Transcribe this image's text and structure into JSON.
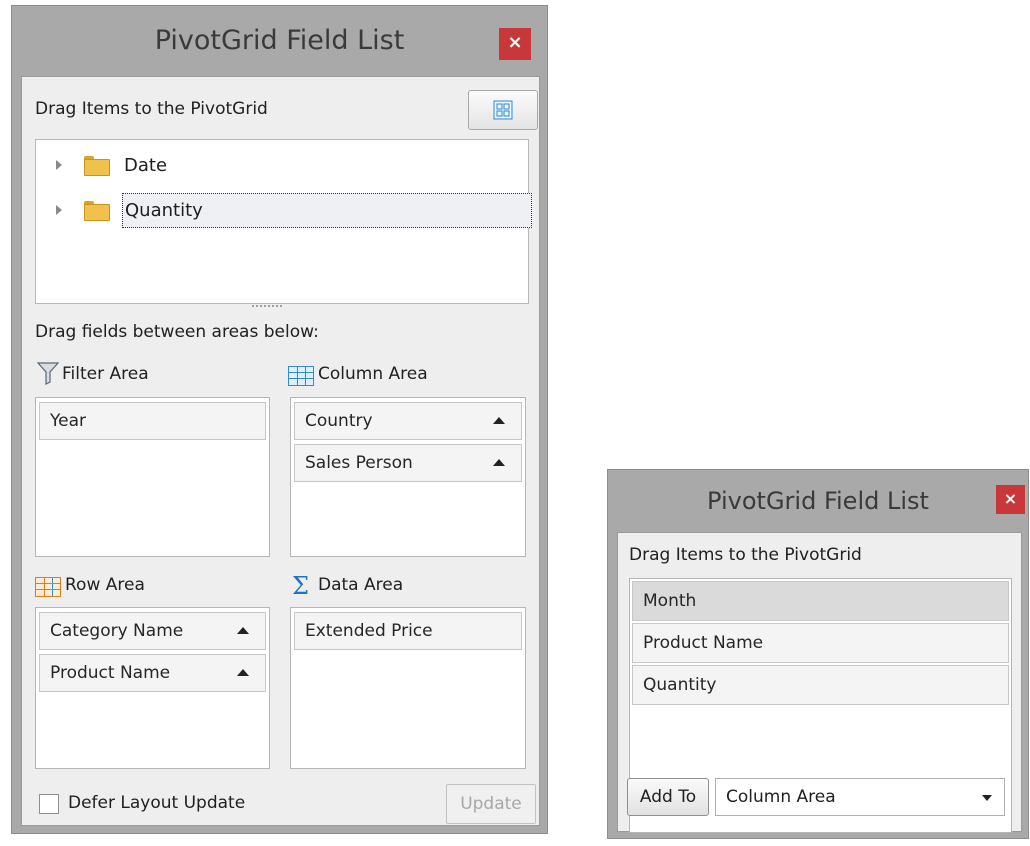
{
  "window_main": {
    "title": "PivotGrid Field List",
    "close_glyph": "×",
    "drag_items_label": "Drag Items to the PivotGrid",
    "tree_nodes": [
      {
        "label": "Date"
      },
      {
        "label": "Quantity"
      }
    ],
    "drag_fields_label": "Drag fields between areas below:",
    "filter_area": {
      "title": "Filter Area",
      "fields": [
        "Year"
      ]
    },
    "column_area": {
      "title": "Column Area",
      "fields": [
        "Country",
        "Sales Person"
      ]
    },
    "row_area": {
      "title": "Row Area",
      "fields": [
        "Category Name",
        "Product Name"
      ]
    },
    "data_area": {
      "title": "Data Area",
      "fields": [
        "Extended Price"
      ]
    },
    "defer_label": "Defer Layout Update",
    "update_label": "Update"
  },
  "window_compact": {
    "title": "PivotGrid Field List",
    "close_glyph": "×",
    "drag_items_label": "Drag Items to the PivotGrid",
    "fields": [
      "Month",
      "Product Name",
      "Quantity"
    ],
    "add_to_label": "Add To",
    "target_area": "Column Area"
  },
  "icons": {
    "filter": "funnel-icon",
    "column": "column-grid-icon",
    "row": "row-grid-icon",
    "data": "sigma-icon",
    "folder": "folder-icon",
    "layout": "layout-grid-icon"
  },
  "colors": {
    "close_button": "#c8373a",
    "icon_blue": "#2f8ad0",
    "icon_orange": "#e07b1e",
    "folder": "#f0c24b"
  }
}
